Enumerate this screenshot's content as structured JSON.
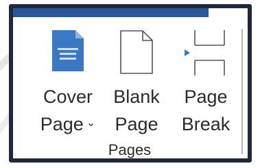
{
  "pages_group": {
    "label": "Pages",
    "commands": [
      {
        "line1": "Cover",
        "line2": "Page",
        "has_dropdown": true,
        "icon": "cover-page-icon"
      },
      {
        "line1": "Blank",
        "line2": "Page",
        "has_dropdown": false,
        "icon": "blank-page-icon"
      },
      {
        "line1": "Page",
        "line2": "Break",
        "has_dropdown": false,
        "icon": "page-break-icon"
      }
    ],
    "dropdown_glyph": "⌄"
  },
  "colors": {
    "frame": "#1e2a3c",
    "accent": "#2b579a",
    "icon_fill": "#3b78c3",
    "text": "#2b2b2b"
  }
}
